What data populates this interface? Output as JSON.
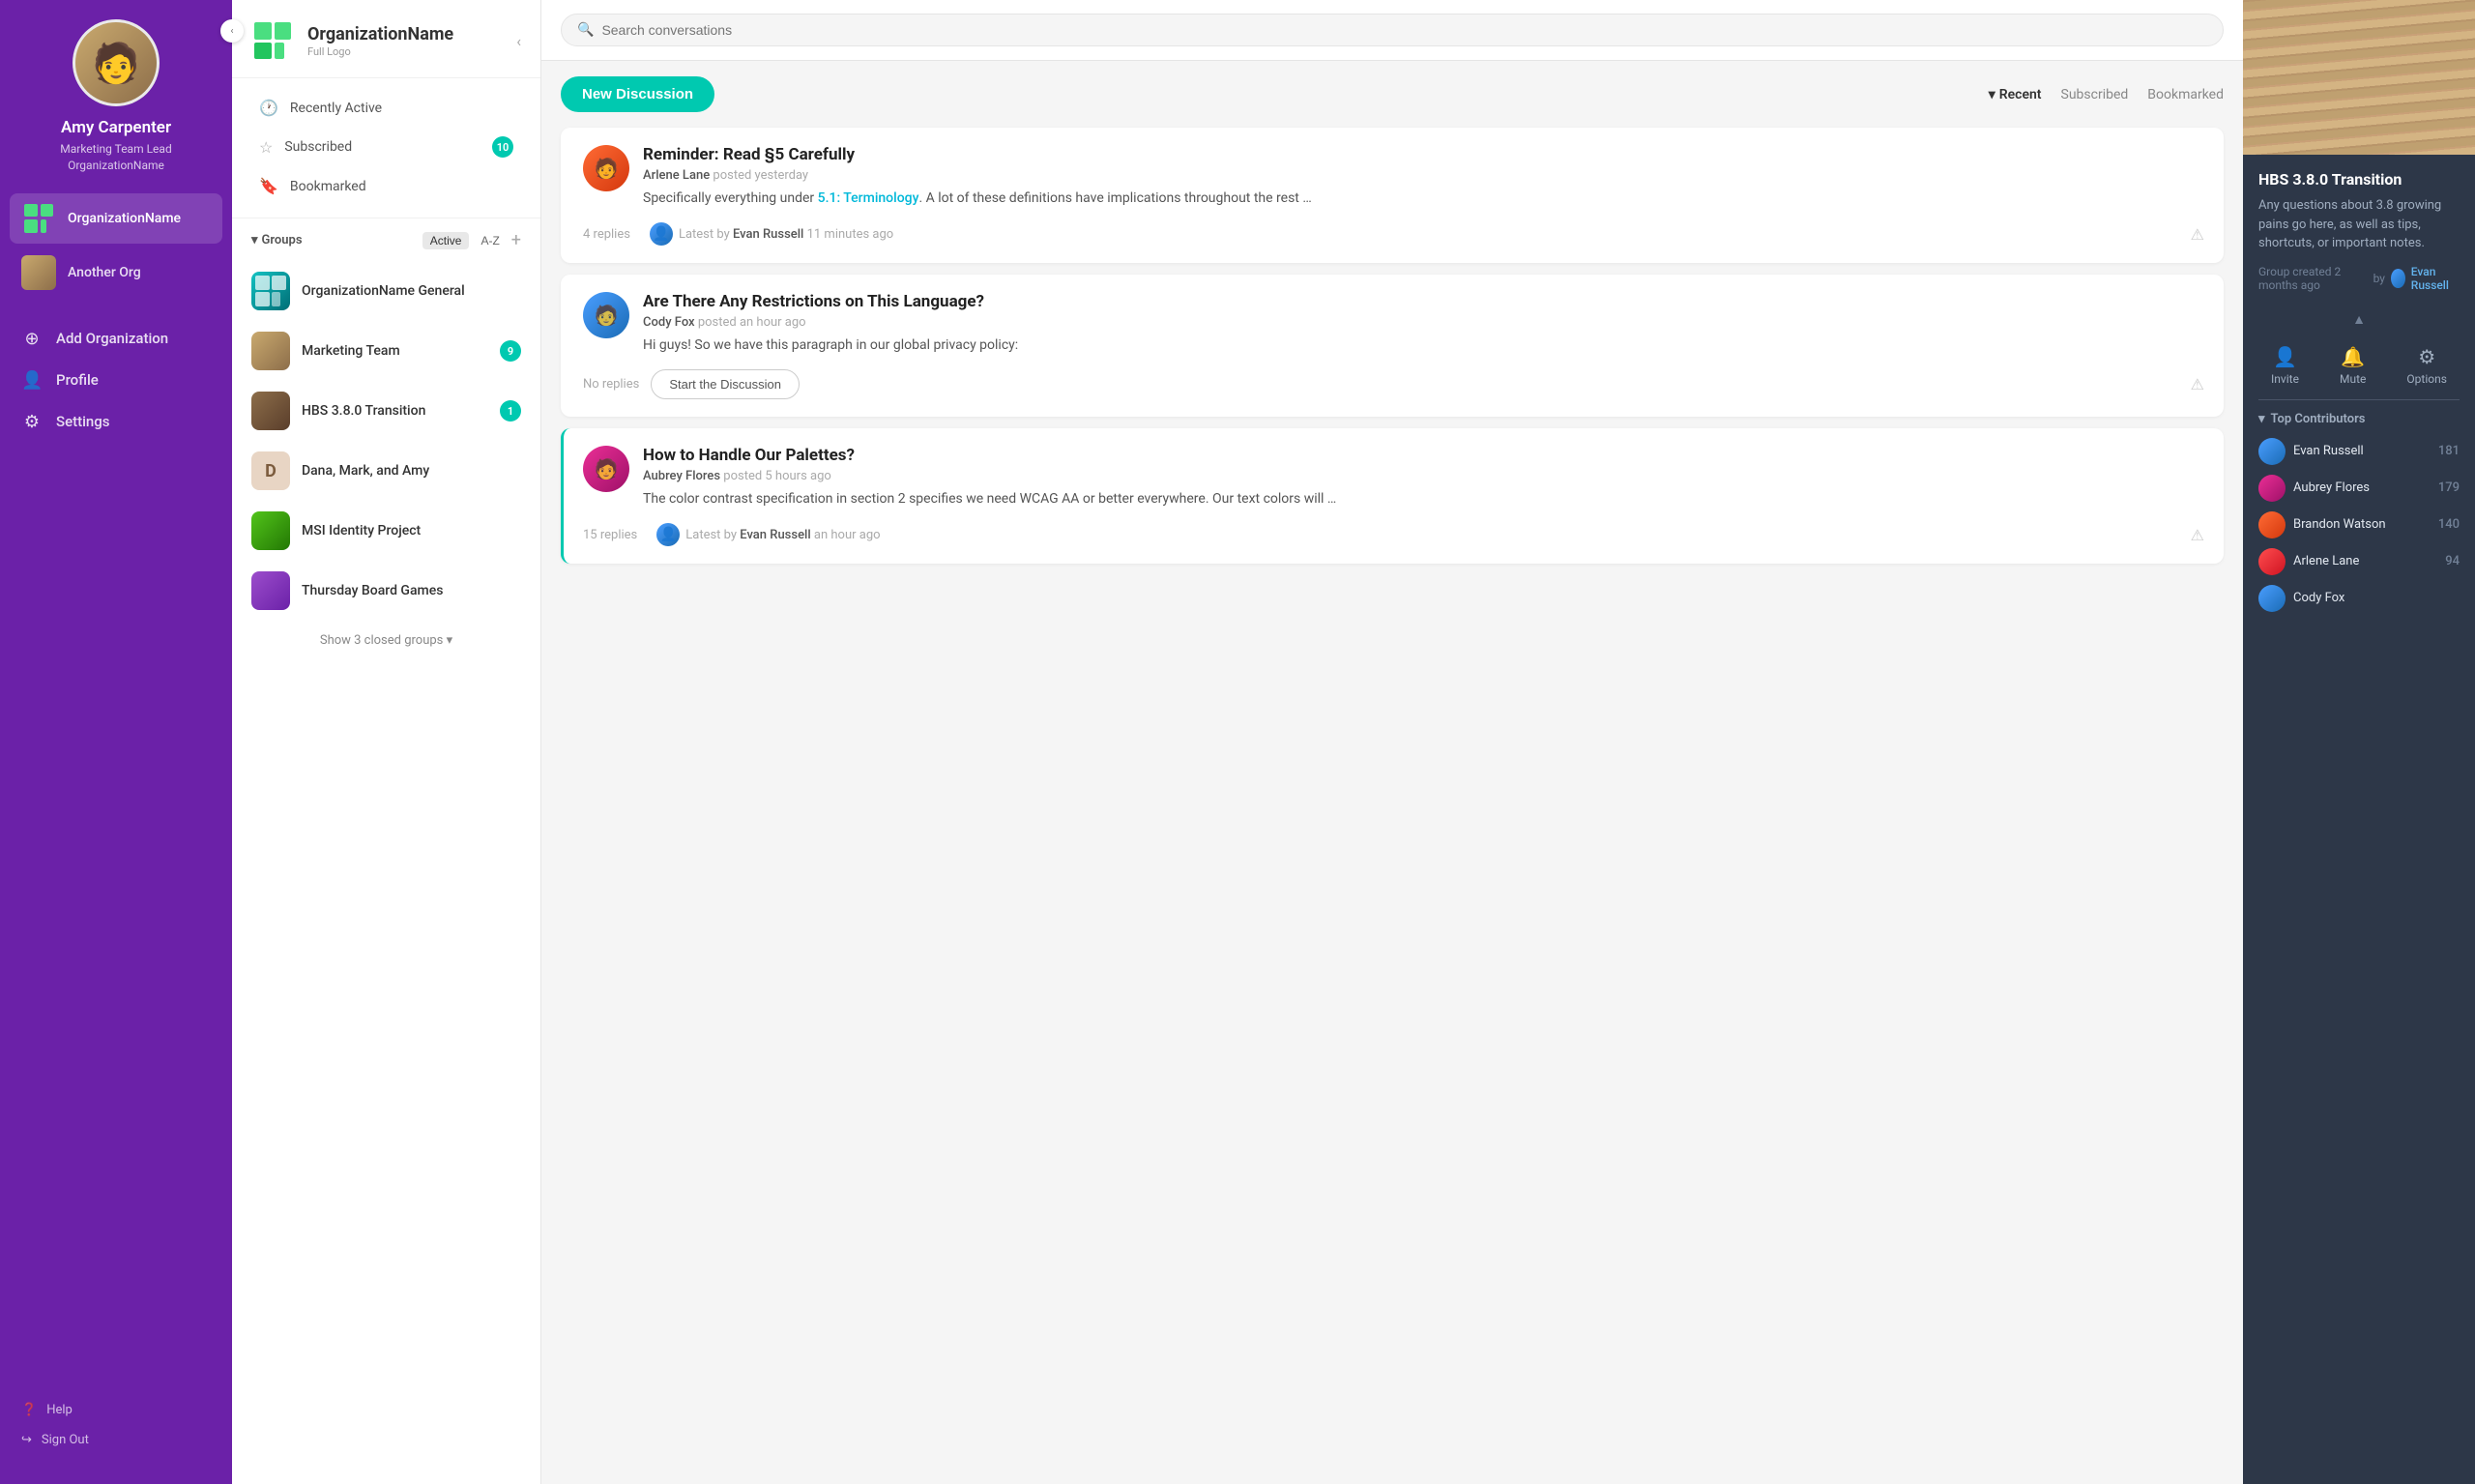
{
  "leftSidebar": {
    "collapseBtn": "‹",
    "user": {
      "name": "Amy Carpenter",
      "role": "Marketing Team Lead",
      "org": "OrganizationName"
    },
    "orgs": [
      {
        "id": "org1",
        "name": "OrganizationName",
        "active": true
      },
      {
        "id": "org2",
        "name": "Another Org",
        "active": false
      }
    ],
    "navItems": [
      {
        "id": "add-org",
        "label": "Add Organization",
        "icon": "⊕"
      },
      {
        "id": "profile",
        "label": "Profile",
        "icon": "👤"
      },
      {
        "id": "settings",
        "label": "Settings",
        "icon": "⚙"
      }
    ],
    "footerItems": [
      {
        "id": "help",
        "label": "Help",
        "icon": "?"
      },
      {
        "id": "signout",
        "label": "Sign Out",
        "icon": "→"
      }
    ]
  },
  "middlePanel": {
    "org": {
      "name": "OrganizationName",
      "subtitle": "Full Logo"
    },
    "collapseBtn": "‹",
    "navLinks": [
      {
        "id": "recently-active",
        "label": "Recently Active",
        "icon": "🕐",
        "badge": null
      },
      {
        "id": "subscribed",
        "label": "Subscribed",
        "icon": "☆",
        "badge": "10"
      },
      {
        "id": "bookmarked",
        "label": "Bookmarked",
        "icon": "🔖",
        "badge": null
      }
    ],
    "groupsSection": {
      "label": "Groups",
      "filters": [
        "Active",
        "A-Z"
      ],
      "activeFilter": "Active",
      "groups": [
        {
          "id": "g1",
          "name": "OrganizationName General",
          "badge": null,
          "colorClass": "av-teal"
        },
        {
          "id": "g2",
          "name": "Marketing Team",
          "badge": "9",
          "colorClass": "av-orange"
        },
        {
          "id": "g3",
          "name": "HBS 3.8.0 Transition",
          "badge": "1",
          "colorClass": "av-blue"
        },
        {
          "id": "g4",
          "name": "Dana, Mark, and Amy",
          "badge": null,
          "colorClass": "av-purple",
          "initial": "D"
        },
        {
          "id": "g5",
          "name": "MSI Identity Project",
          "badge": null,
          "colorClass": "av-green"
        },
        {
          "id": "g6",
          "name": "Thursday Board Games",
          "badge": null,
          "colorClass": "av-red"
        }
      ],
      "showClosedLabel": "Show 3 closed groups"
    }
  },
  "mainContent": {
    "search": {
      "placeholder": "Search conversations"
    },
    "header": {
      "newDiscussionBtn": "New Discussion",
      "tabs": [
        {
          "id": "recent",
          "label": "Recent",
          "active": true,
          "hasArrow": true
        },
        {
          "id": "subscribed",
          "label": "Subscribed",
          "active": false
        },
        {
          "id": "bookmarked",
          "label": "Bookmarked",
          "active": false
        }
      ]
    },
    "discussions": [
      {
        "id": "d1",
        "title": "Reminder: Read §5 Carefully",
        "author": "Arlene Lane",
        "time": "posted yesterday",
        "excerpt": "Specifically everything under ",
        "excerptLink": "5.1: Terminology",
        "excerptAfter": ". A lot of these definitions have implications throughout the rest …",
        "repliesCount": "4 replies",
        "latestAuthor": "Evan Russell",
        "latestTime": "11 minutes ago",
        "highlighted": false,
        "avatarClass": "av-orange",
        "latestAvatarClass": "av-blue"
      },
      {
        "id": "d2",
        "title": "Are There Any Restrictions on This Language?",
        "author": "Cody Fox",
        "time": "posted an hour ago",
        "excerpt": "Hi guys! So we have this paragraph in our global privacy policy:",
        "excerptLink": null,
        "excerptAfter": "",
        "repliesCount": "No replies",
        "latestAuthor": null,
        "latestTime": null,
        "startDiscussion": "Start the Discussion",
        "highlighted": false,
        "avatarClass": "av-blue",
        "latestAvatarClass": null
      },
      {
        "id": "d3",
        "title": "How to Handle Our Palettes?",
        "author": "Aubrey Flores",
        "time": "posted 5 hours ago",
        "excerpt": "The color contrast specification in section 2 specifies we need WCAG AA or better everywhere. Our text colors will …",
        "excerptLink": null,
        "excerptAfter": "",
        "repliesCount": "15 replies",
        "latestAuthor": "Evan Russell",
        "latestTime": "an hour ago",
        "highlighted": true,
        "avatarClass": "av-pink",
        "latestAvatarClass": "av-blue"
      }
    ]
  },
  "rightPanel": {
    "group": {
      "title": "HBS 3.8.0 Transition",
      "description": "Any questions about 3.8 growing pains go here, as well as tips, shortcuts, or important notes.",
      "createdTime": "Group created 2 months ago",
      "createdBy": "by",
      "createdAuthor": "Evan Russell"
    },
    "actions": [
      {
        "id": "invite",
        "label": "Invite",
        "icon": "👤+"
      },
      {
        "id": "mute",
        "label": "Mute",
        "icon": "🔔"
      },
      {
        "id": "options",
        "label": "Options",
        "icon": "⚙"
      }
    ],
    "contributors": {
      "title": "Top Contributors",
      "list": [
        {
          "name": "Evan Russell",
          "count": "181",
          "avatarClass": "av-blue"
        },
        {
          "name": "Aubrey Flores",
          "count": "179",
          "avatarClass": "av-pink"
        },
        {
          "name": "Brandon Watson",
          "count": "140",
          "avatarClass": "av-orange"
        },
        {
          "name": "Arlene Lane",
          "count": "94",
          "avatarClass": "av-red"
        },
        {
          "name": "Cody Fox",
          "count": "",
          "avatarClass": "av-blue"
        }
      ]
    }
  }
}
